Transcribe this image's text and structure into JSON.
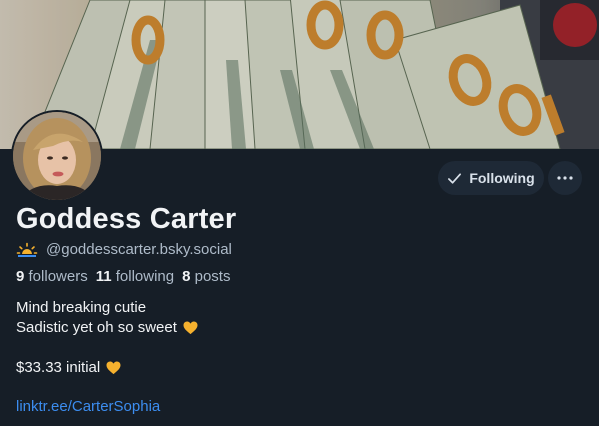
{
  "profile": {
    "display_name": "Goddess Carter",
    "handle": "@goddesscarter.bsky.social",
    "handle_emoji_icon": "sunrise-icon"
  },
  "actions": {
    "follow_label": "Following",
    "follow_icon": "checkmark-icon",
    "more_icon": "ellipsis-icon"
  },
  "stats": {
    "followers_count": "9",
    "followers_label": "followers",
    "following_count": "11",
    "following_label": "following",
    "posts_count": "8",
    "posts_label": "posts"
  },
  "bio": {
    "line1": "Mind breaking cutie",
    "line2": "Sadistic yet oh so sweet",
    "line3": "$33.33 initial",
    "heart_icon": "yellow-heart-icon",
    "link": "linktr.ee/CarterSophia"
  },
  "colors": {
    "background": "#161e27",
    "button_bg": "#1e2936",
    "link": "#3c8df0",
    "muted_text": "#aebbc9",
    "heart": "#f5b12e"
  }
}
